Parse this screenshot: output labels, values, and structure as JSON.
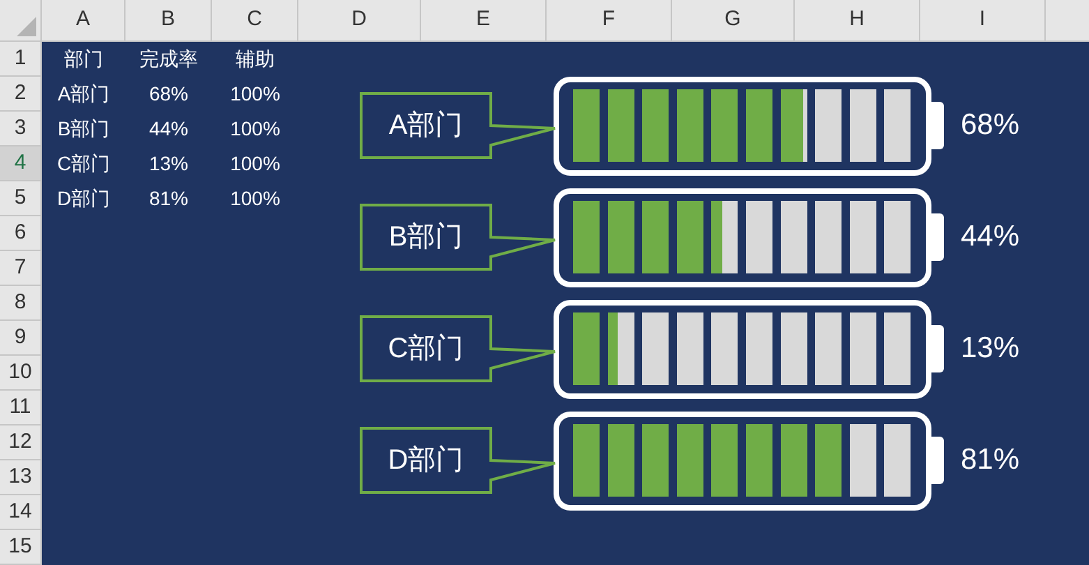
{
  "sheet": {
    "column_headers": [
      "A",
      "B",
      "C",
      "D",
      "E",
      "F",
      "G",
      "H",
      "I"
    ],
    "row_headers": [
      {
        "label": "1",
        "selected": false
      },
      {
        "label": "2",
        "selected": false
      },
      {
        "label": "3",
        "selected": false
      },
      {
        "label": "4",
        "selected": true
      },
      {
        "label": "5",
        "selected": false
      },
      {
        "label": "6",
        "selected": false
      },
      {
        "label": "7",
        "selected": false
      },
      {
        "label": "8",
        "selected": false
      },
      {
        "label": "9",
        "selected": false
      },
      {
        "label": "10",
        "selected": false
      },
      {
        "label": "11",
        "selected": false
      },
      {
        "label": "12",
        "selected": false
      },
      {
        "label": "13",
        "selected": false
      },
      {
        "label": "14",
        "selected": false
      },
      {
        "label": "15",
        "selected": false
      }
    ],
    "table": {
      "columns": [
        "部门",
        "完成率",
        "辅助"
      ],
      "rows": [
        [
          "A部门",
          "68%",
          "100%"
        ],
        [
          "B部门",
          "44%",
          "100%"
        ],
        [
          "C部门",
          "13%",
          "100%"
        ],
        [
          "D部门",
          "81%",
          "100%"
        ]
      ]
    }
  },
  "chart": {
    "batteries": [
      {
        "label": "A部门",
        "level": 0.68,
        "reading": "68%"
      },
      {
        "label": "B部门",
        "level": 0.44,
        "reading": "44%"
      },
      {
        "label": "C部门",
        "level": 0.13,
        "reading": "13%"
      },
      {
        "label": "D部门",
        "level": 0.81,
        "reading": "81%"
      }
    ]
  }
}
